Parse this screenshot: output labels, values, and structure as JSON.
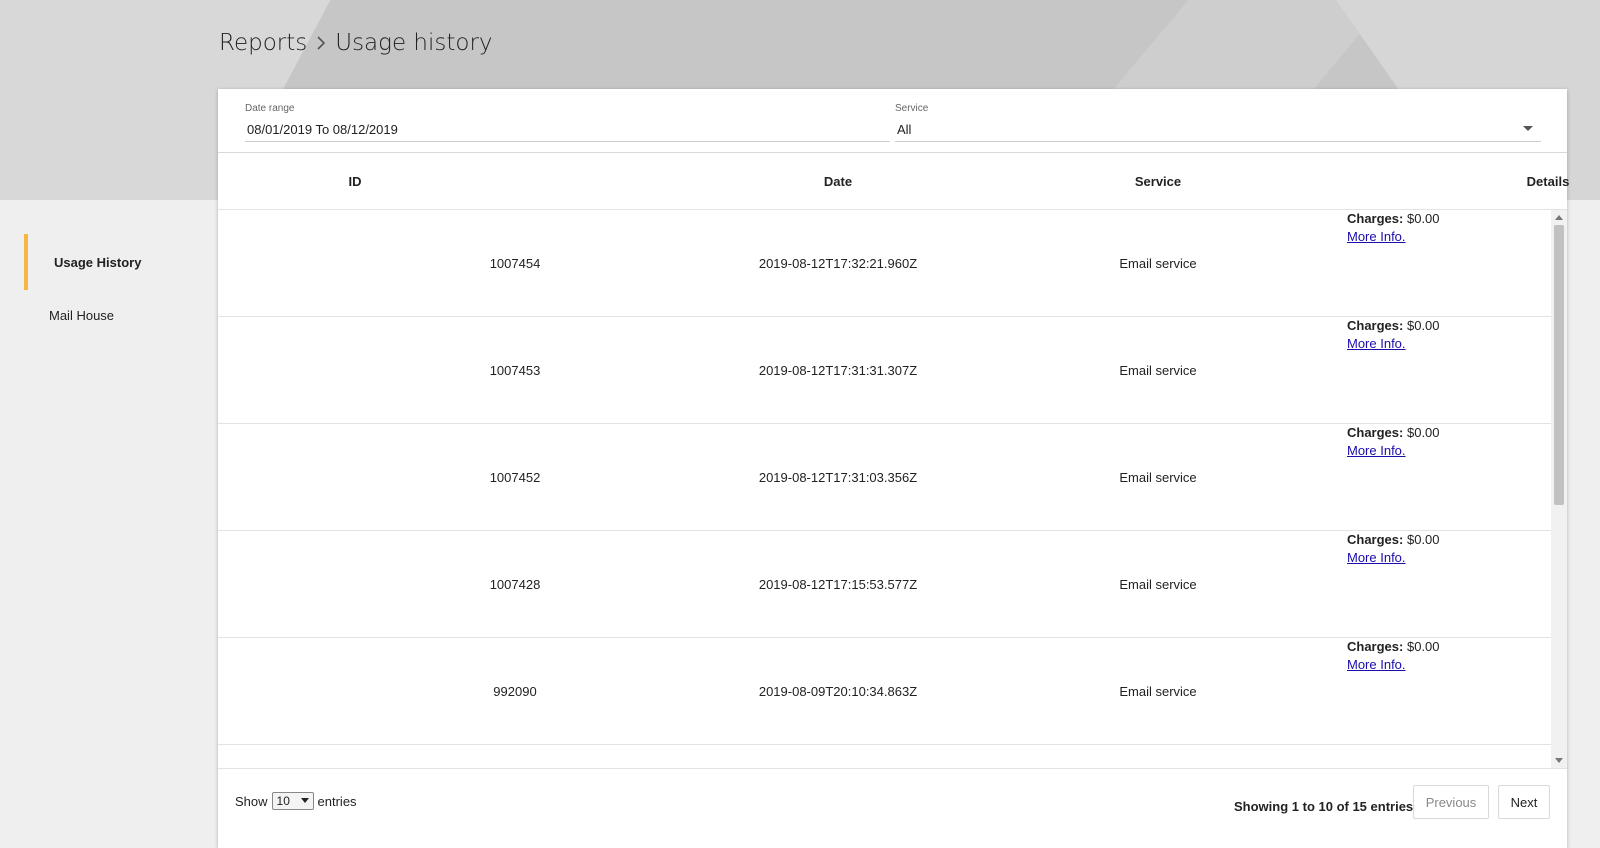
{
  "breadcrumb": {
    "parent": "Reports",
    "current": "Usage history"
  },
  "sidebar": {
    "items": [
      {
        "label": "Usage History",
        "active": true
      },
      {
        "label": "Mail House",
        "active": false
      }
    ]
  },
  "filters": {
    "date_range_label": "Date range",
    "date_range_value": "08/01/2019 To 08/12/2019",
    "service_label": "Service",
    "service_value": "All"
  },
  "table": {
    "columns": [
      "ID",
      "Date",
      "Service",
      "Details"
    ],
    "charges_label": "Charges:",
    "more_info_label": "More Info.",
    "rows": [
      {
        "id": "1007454",
        "date": "2019-08-12T17:32:21.960Z",
        "service": "Email service",
        "charges": "$0.00"
      },
      {
        "id": "1007453",
        "date": "2019-08-12T17:31:31.307Z",
        "service": "Email service",
        "charges": "$0.00"
      },
      {
        "id": "1007452",
        "date": "2019-08-12T17:31:03.356Z",
        "service": "Email service",
        "charges": "$0.00"
      },
      {
        "id": "1007428",
        "date": "2019-08-12T17:15:53.577Z",
        "service": "Email service",
        "charges": "$0.00"
      },
      {
        "id": "992090",
        "date": "2019-08-09T20:10:34.863Z",
        "service": "Email service",
        "charges": "$0.00"
      }
    ]
  },
  "footer": {
    "show_label": "Show",
    "page_size": "10",
    "entries_label": "entries",
    "info": "Showing 1 to 10 of 15 entries",
    "previous_label": "Previous",
    "next_label": "Next"
  },
  "colors": {
    "accent": "#f4b942",
    "link": "#1a0dab"
  },
  "icons": {
    "breadcrumb_separator": "chevron-right-icon",
    "service_dropdown": "caret-down-icon"
  }
}
